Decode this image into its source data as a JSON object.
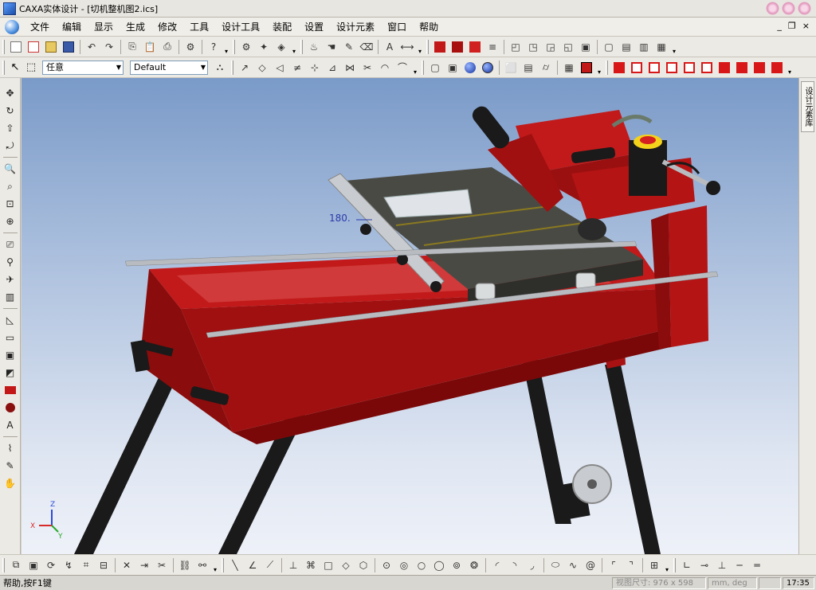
{
  "window": {
    "title": "CAXA实体设计 - [切机整机图2.ics]"
  },
  "menu": {
    "items": [
      "文件",
      "编辑",
      "显示",
      "生成",
      "修改",
      "工具",
      "设计工具",
      "装配",
      "设置",
      "设计元素",
      "窗口",
      "帮助"
    ]
  },
  "toolbar2": {
    "selection_mode": "任意",
    "style": "Default"
  },
  "right_panel": {
    "tab_label": "设计元素库"
  },
  "viewport": {
    "angle_label": "180.",
    "triad": {
      "x": "X",
      "y": "Y",
      "z": "Z"
    }
  },
  "status": {
    "help": "帮助,按F1键",
    "view_size": "视图尺寸: 976 x 598",
    "unit": "mm, deg",
    "time": "17:35"
  },
  "colors": {
    "frame_red": "#b81414",
    "leg_black": "#1a1a1a",
    "table_gray": "#4a4a44",
    "rail_silver": "#b8bcc0"
  }
}
